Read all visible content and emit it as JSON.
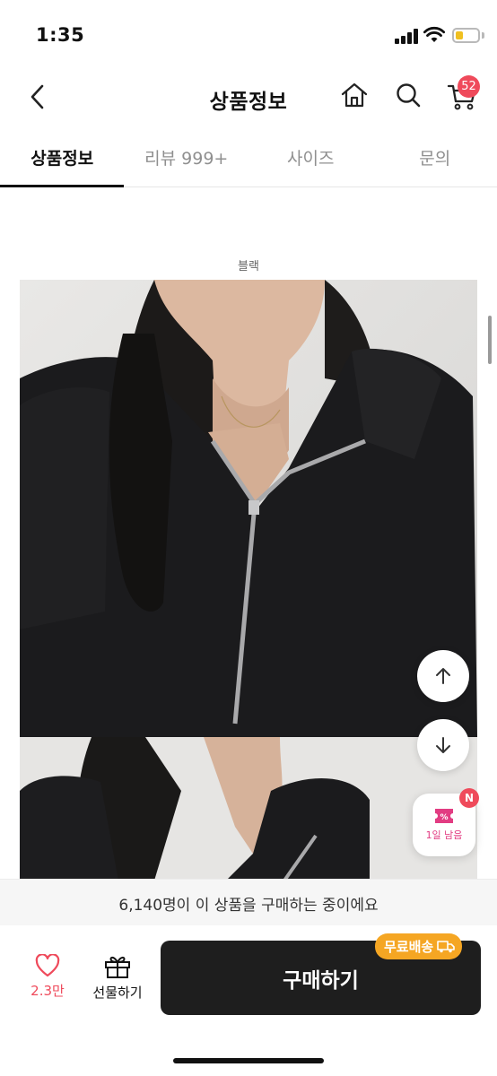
{
  "status_bar": {
    "time": "1:35"
  },
  "header": {
    "title": "상품정보",
    "cart_count": "52"
  },
  "tabs": [
    {
      "label": "상품정보",
      "active": true
    },
    {
      "label": "리뷰 999+",
      "active": false
    },
    {
      "label": "사이즈",
      "active": false
    },
    {
      "label": "문의",
      "active": false
    }
  ],
  "product": {
    "color_label": "블랙"
  },
  "floating": {
    "coupon_text": "1일 남음",
    "coupon_badge": "N"
  },
  "notice": {
    "purchase_text": "6,140명이 이 상품을 구매하는 중이에요"
  },
  "bottom_bar": {
    "like_count": "2.3만",
    "gift_label": "선물하기",
    "buy_label": "구매하기",
    "free_shipping_label": "무료배송"
  },
  "colors": {
    "accent": "#ef4a5b",
    "buy_button": "#1e1e1e",
    "shipping_tag": "#f5a623",
    "coupon": "#e23c82"
  },
  "icons": [
    "back-icon",
    "home-icon",
    "search-icon",
    "cart-icon",
    "arrow-up-icon",
    "arrow-down-icon",
    "coupon-icon",
    "heart-icon",
    "gift-icon",
    "truck-icon"
  ]
}
